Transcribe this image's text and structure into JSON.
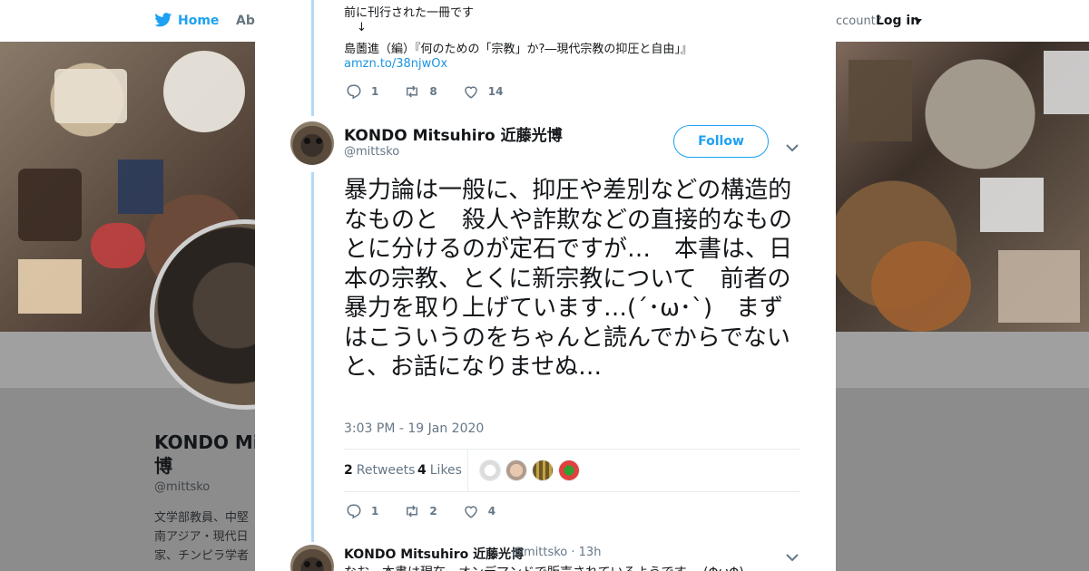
{
  "nav": {
    "home": "Home",
    "about": "Abo",
    "account_question": "ccount?",
    "login": "Log in"
  },
  "profile": {
    "name": "KONDO Mit 博",
    "handle": "@mittsko",
    "bio": "文学部教員、中堅 南アジア・現代日 家、チンピラ学者 "
  },
  "thread": {
    "prev_line1": "前に刊行された一冊です",
    "prev_arrow": "↓",
    "prev_line3": "島薗進（編）『何のための「宗教」か?―現代宗教の抑圧と自由」』",
    "prev_link": "amzn.to/38njwOx",
    "prev_actions": {
      "reply": "1",
      "retweet": "8",
      "like": "14"
    }
  },
  "tweet": {
    "author_name": "KONDO Mitsuhiro 近藤光博",
    "author_handle": "@mittsko",
    "follow_label": "Follow",
    "text": "暴力論は一般に、抑圧や差別などの構造的なものと　殺人や詐欺などの直接的なものとに分けるのが定石ですが…　本書は、日本の宗教、とくに新宗教について　前者の暴力を取り上げています…(´･ω･`)　まずはこういうのをちゃんと読んでからでないと、お話になりませぬ…",
    "time": "3:03 PM - 19 Jan 2020",
    "retweets_count": "2",
    "retweets_label": "Retweets",
    "likes_count": "4",
    "likes_label": "Likes",
    "actions": {
      "reply": "1",
      "retweet": "2",
      "like": "4"
    }
  },
  "reply": {
    "author_name": "KONDO Mitsuhiro 近藤光博",
    "meta": "@mittsko · 13h",
    "text": "なお、本書は現在、オンデマンドで販売されているようです… (ΦωΦ)"
  },
  "colors": {
    "accent": "#1da1f2",
    "thread_line": "#b3d9f7",
    "muted": "#657786"
  },
  "icons": [
    "twitter-bird-icon",
    "close-icon",
    "reply-icon",
    "retweet-icon",
    "like-icon",
    "chevron-down-icon"
  ]
}
